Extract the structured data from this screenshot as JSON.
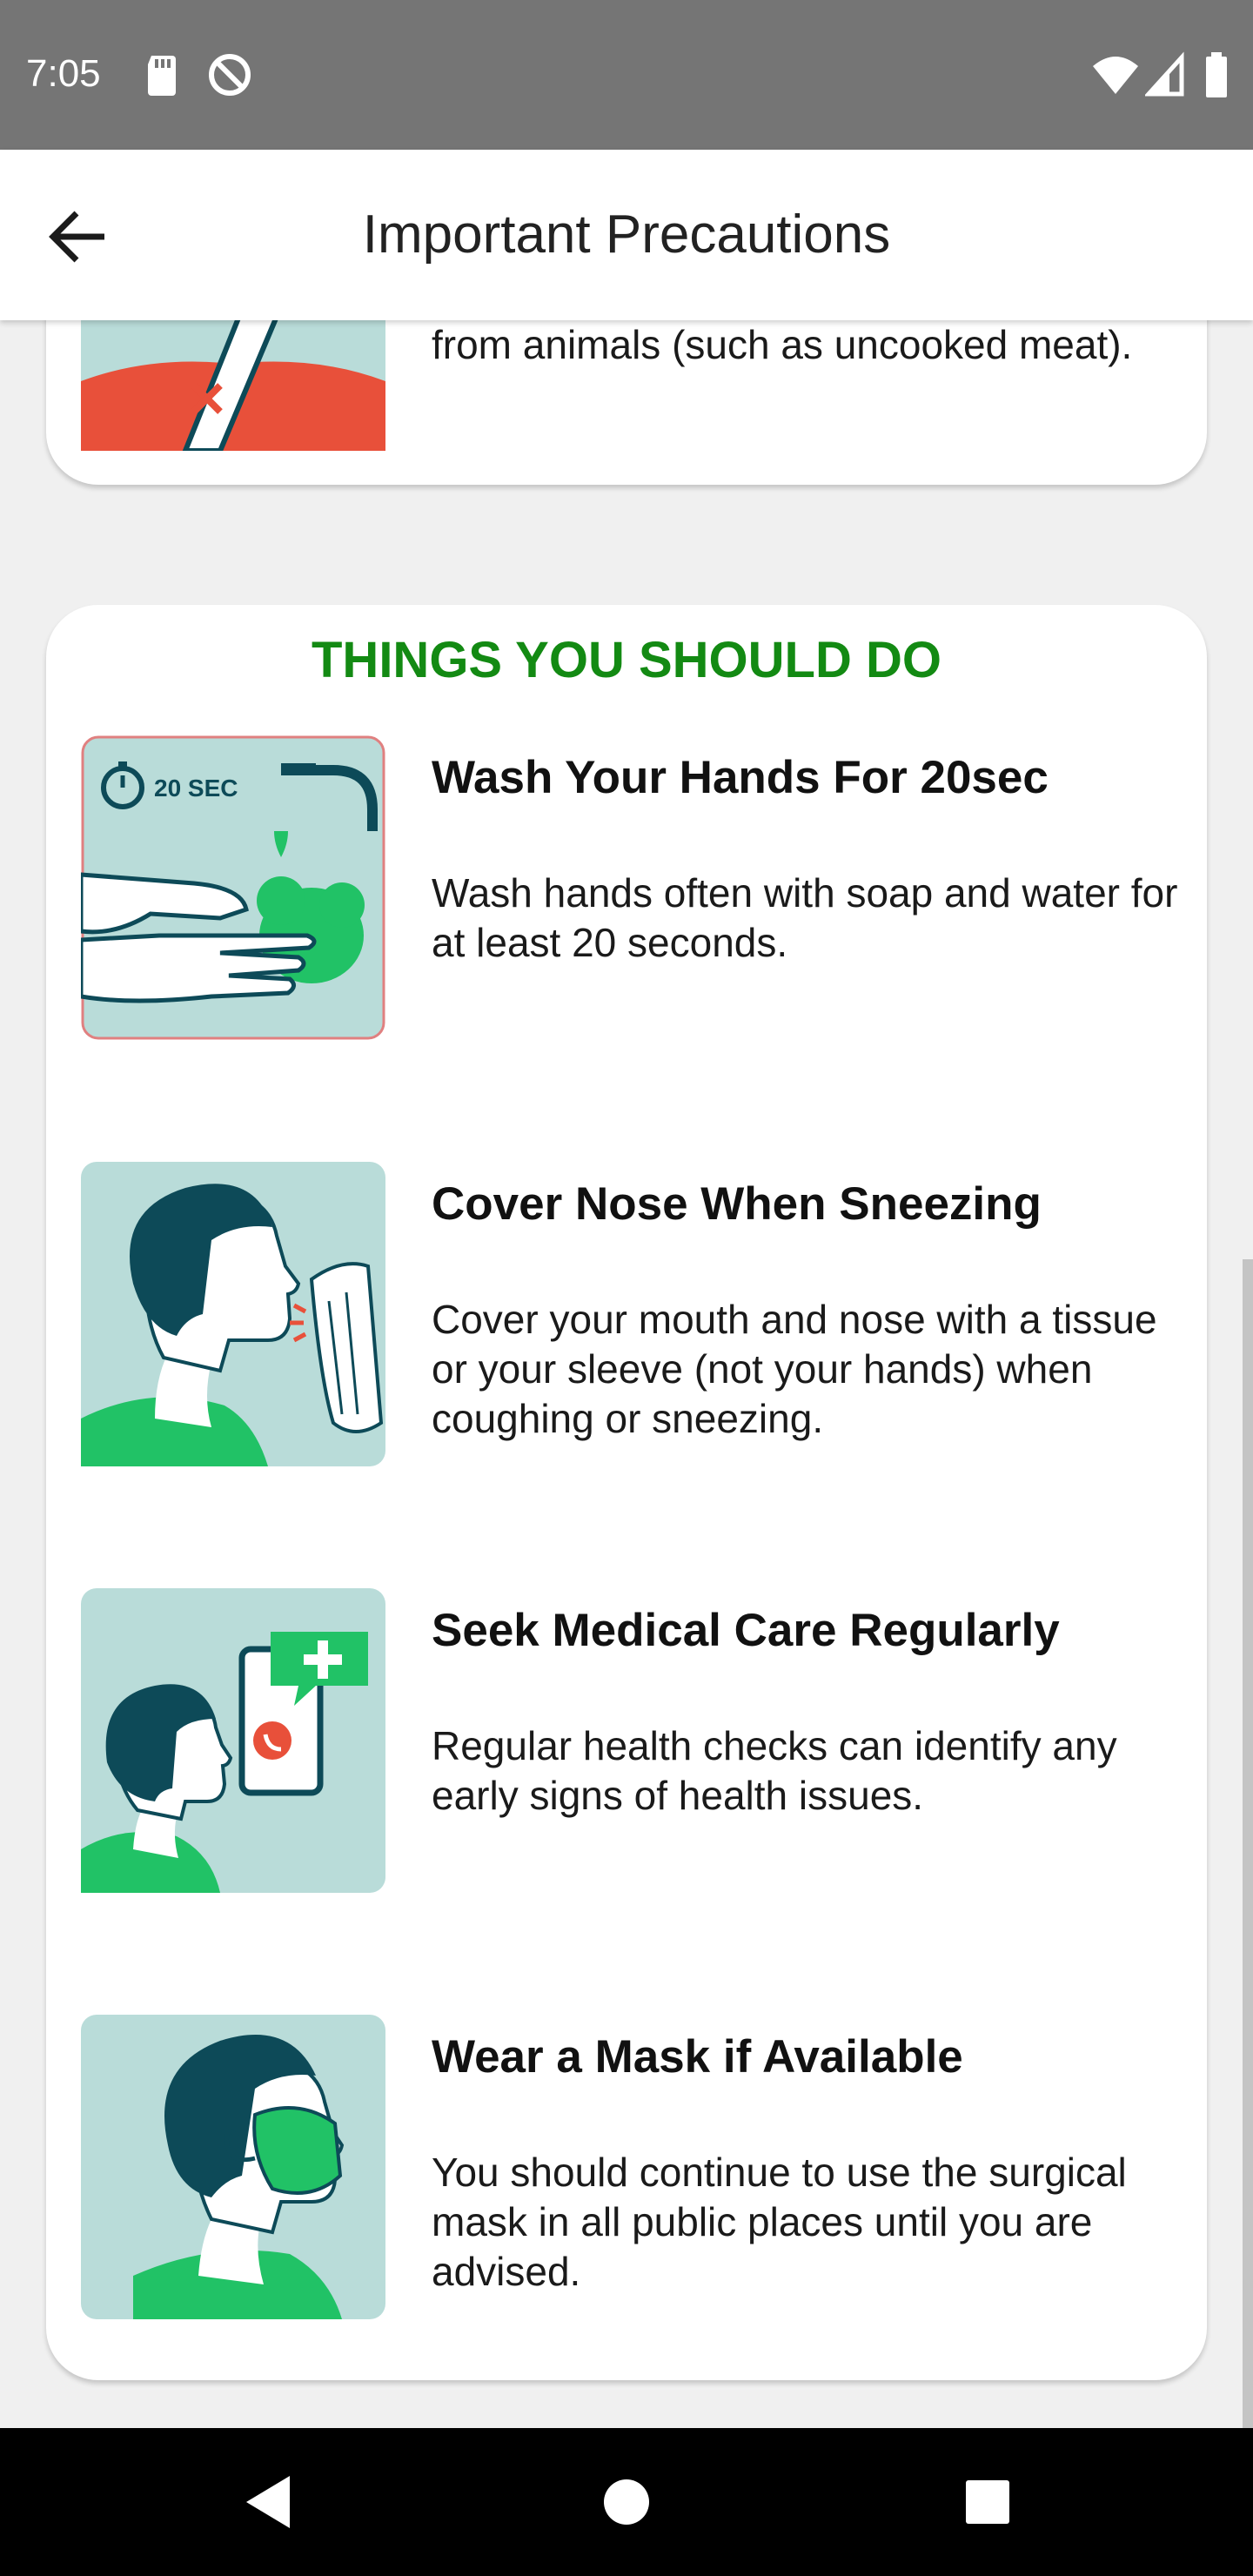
{
  "status_bar": {
    "time": "7:05",
    "icons": [
      "sd-card-icon",
      "no-disturb-icon",
      "wifi-icon",
      "signal-icon",
      "battery-icon"
    ]
  },
  "app_bar": {
    "title": "Important Precautions",
    "back_icon": "arrow-left-icon"
  },
  "previous_card": {
    "description": "animal markets, and products that come from animals (such as uncooked meat)."
  },
  "do_section": {
    "heading": "THINGS YOU SHOULD DO",
    "items": [
      {
        "title": "Wash Your Hands For 20sec",
        "description": "Wash hands often with soap and water for at least 20 seconds.",
        "image_text": "20 SEC",
        "icon": "wash-hands-icon"
      },
      {
        "title": "Cover Nose When Sneezing",
        "description": "Cover your mouth and nose with a tissue or your sleeve (not your hands) when coughing or sneezing.",
        "icon": "sneeze-tissue-icon"
      },
      {
        "title": "Seek Medical Care Regularly",
        "description": "Regular health checks can identify any early signs of health issues.",
        "icon": "medical-call-icon"
      },
      {
        "title": "Wear a Mask if Available",
        "description": "You should continue to use the surgical mask in all public places until you are advised.",
        "icon": "face-mask-icon"
      }
    ]
  },
  "nav_bar": {
    "buttons": [
      "back-triangle-icon",
      "home-circle-icon",
      "recents-square-icon"
    ]
  },
  "colors": {
    "heading_green": "#138a13",
    "icon_bg": "#b9dcd9",
    "figure_dark": "#0d4a58",
    "figure_green": "#21c266",
    "accent_red": "#e8503a"
  }
}
